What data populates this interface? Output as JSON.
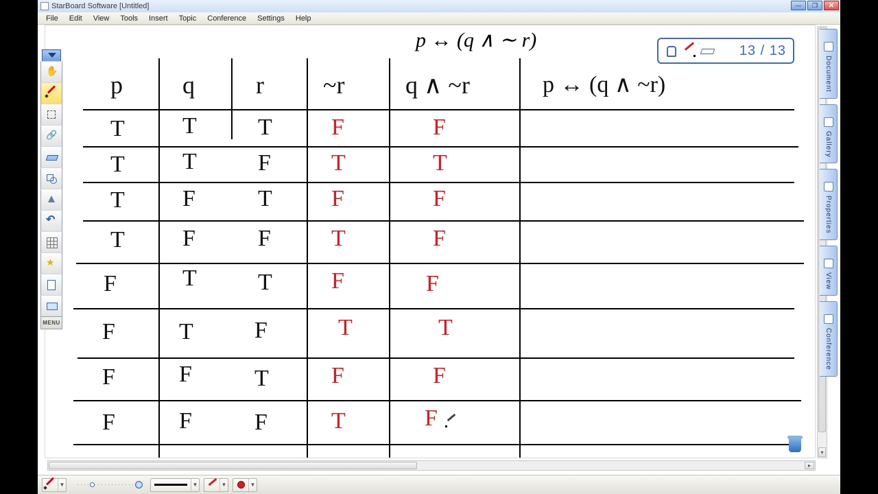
{
  "window": {
    "title": "StarBoard Software [Untitled]"
  },
  "menu": {
    "items": [
      "File",
      "Edit",
      "View",
      "Tools",
      "Insert",
      "Topic",
      "Conference",
      "Settings",
      "Help"
    ]
  },
  "sidetabs": {
    "labels": [
      "Document",
      "Gallery",
      "Properties",
      "View",
      "Conference"
    ]
  },
  "indicator": {
    "page_text": "13 / 13"
  },
  "left_toolbar": {
    "menu_label": "MENU"
  },
  "formula": {
    "typed": "p ↔ (q ∧ ∼ r)"
  },
  "table": {
    "headers": [
      "p",
      "q",
      "r",
      "~r",
      "q ∧ ~r",
      "p ↔ (q ∧ ~r)"
    ],
    "rows": [
      {
        "p": "T",
        "q": "T",
        "r": "T",
        "nr": "F",
        "qnr": "F",
        "res": ""
      },
      {
        "p": "T",
        "q": "T",
        "r": "F",
        "nr": "T",
        "qnr": "T",
        "res": ""
      },
      {
        "p": "T",
        "q": "F",
        "r": "T",
        "nr": "F",
        "qnr": "F",
        "res": ""
      },
      {
        "p": "T",
        "q": "F",
        "r": "F",
        "nr": "T",
        "qnr": "F",
        "res": ""
      },
      {
        "p": "F",
        "q": "T",
        "r": "T",
        "nr": "F",
        "qnr": "F",
        "res": ""
      },
      {
        "p": "F",
        "q": "T",
        "r": "F",
        "nr": "T",
        "qnr": "T",
        "res": ""
      },
      {
        "p": "F",
        "q": "F",
        "r": "T",
        "nr": "F",
        "qnr": "F",
        "res": ""
      },
      {
        "p": "F",
        "q": "F",
        "r": "F",
        "nr": "T",
        "qnr": "F",
        "res": ""
      }
    ]
  },
  "chart_data": {
    "type": "table",
    "title": "Truth table for p ↔ (q ∧ ~r)",
    "columns": [
      "p",
      "q",
      "r",
      "~r",
      "q ∧ ~r",
      "p ↔ (q ∧ ~r)"
    ],
    "rows": [
      [
        "T",
        "T",
        "T",
        "F",
        "F",
        ""
      ],
      [
        "T",
        "T",
        "F",
        "T",
        "T",
        ""
      ],
      [
        "T",
        "F",
        "T",
        "F",
        "F",
        ""
      ],
      [
        "T",
        "F",
        "F",
        "T",
        "F",
        ""
      ],
      [
        "F",
        "T",
        "T",
        "F",
        "F",
        ""
      ],
      [
        "F",
        "T",
        "F",
        "T",
        "T",
        ""
      ],
      [
        "F",
        "F",
        "T",
        "F",
        "F",
        ""
      ],
      [
        "F",
        "F",
        "F",
        "T",
        "F",
        ""
      ]
    ]
  }
}
